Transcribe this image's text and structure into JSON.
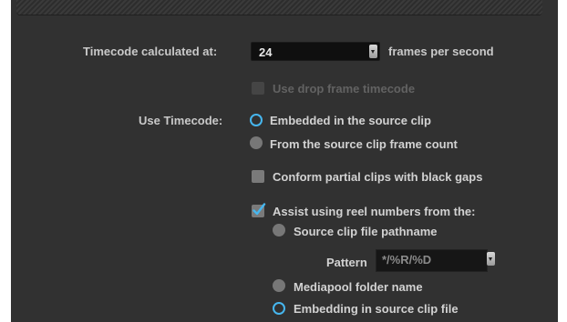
{
  "timecode": {
    "label": "Timecode calculated at:",
    "fps_value": "24",
    "fps_suffix": "frames per second"
  },
  "drop_frame": {
    "label": "Use drop frame timecode",
    "checked": false,
    "enabled": false
  },
  "use_timecode": {
    "label": "Use Timecode:",
    "options": [
      {
        "label": "Embedded in the source clip",
        "selected": true
      },
      {
        "label": "From the source clip frame count",
        "selected": false
      }
    ]
  },
  "conform_partial": {
    "label": "Conform partial clips with black gaps",
    "checked": false
  },
  "assist_reel": {
    "label": "Assist using reel numbers from the:",
    "checked": true,
    "options": [
      {
        "label": "Source clip file pathname",
        "selected": false
      },
      {
        "label": "Mediapool folder name",
        "selected": false
      },
      {
        "label": "Embedding in source clip file",
        "selected": true
      }
    ],
    "pattern_label": "Pattern",
    "pattern_value": "*/%R/%D"
  },
  "colors": {
    "panel_bg": "#313131",
    "accent_blue": "#46b6ee",
    "label_text": "#c9c9c9"
  }
}
